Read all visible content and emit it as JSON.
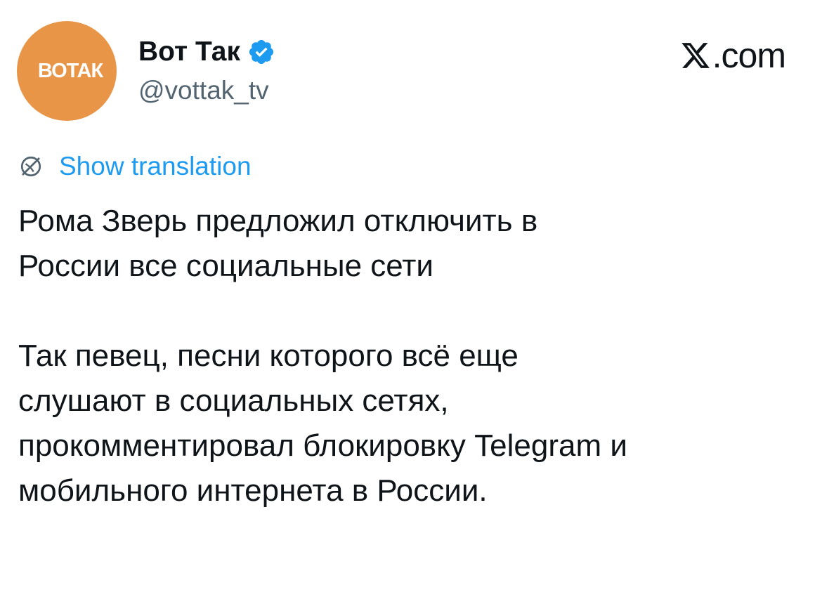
{
  "author": {
    "avatar_text": "ВОТАК",
    "display_name": "Вот Так",
    "handle": "@vottak_tv",
    "verified_icon": "verified-badge-icon",
    "avatar_color": "#e89548",
    "verified_color": "#1d9bf0"
  },
  "brand": {
    "icon": "x-logo-icon",
    "text": ".com"
  },
  "translation": {
    "icon": "globe-icon",
    "label": "Show translation",
    "color": "#1d9bf0"
  },
  "tweet": {
    "paragraphs": [
      "Рома Зверь предложил отключить в\nРоссии все социальные сети",
      "Так певец, песни которого всё еще\nслушают в социальных сетях,\nпрокомментировал блокировку Telegram и\nмобильного интернета в России."
    ]
  }
}
